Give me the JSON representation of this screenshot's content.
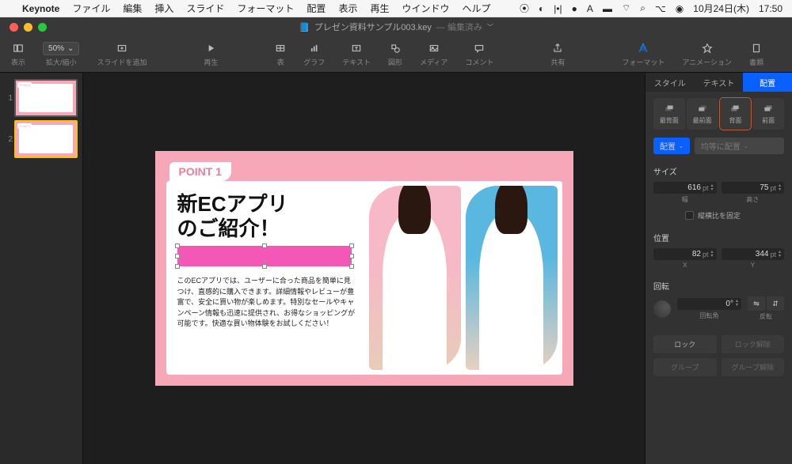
{
  "menubar": {
    "app": "Keynote",
    "items": [
      "ファイル",
      "編集",
      "挿入",
      "スライド",
      "フォーマット",
      "配置",
      "表示",
      "再生",
      "ウインドウ",
      "ヘルプ"
    ],
    "date": "10月24日(木)",
    "time": "17:50"
  },
  "titlebar": {
    "filename": "プレゼン資料サンプル003.key",
    "edited": "編集済み"
  },
  "toolbar": {
    "view": "表示",
    "zoom": "50%",
    "zoom_label": "拡大/縮小",
    "add_slide": "スライドを追加",
    "play": "再生",
    "table": "表",
    "chart": "グラフ",
    "text": "テキスト",
    "shape": "図形",
    "media": "メディア",
    "comment": "コメント",
    "share": "共有",
    "format": "フォーマット",
    "animate": "アニメーション",
    "document": "書類"
  },
  "slides": [
    {
      "num": "1",
      "selected": false
    },
    {
      "num": "2",
      "selected": true
    }
  ],
  "slide": {
    "tag": "POINT 1",
    "title_l1": "新ECアプリ",
    "title_l2": "のご紹介！",
    "body": "このECアプリでは、ユーザーに合った商品を簡単に見つけ、直感的に購入できます。詳細情報やレビューが豊富で、安全に買い物が楽しめます。特別なセールやキャンペーン情報も迅速に提供され、お得なショッピングが可能です。快適な買い物体験をお試しください！"
  },
  "inspector": {
    "tabs": {
      "style": "スタイル",
      "text": "テキスト",
      "arrange": "配置"
    },
    "layers": {
      "back_most": "最背面",
      "front_most": "最前面",
      "back": "背面",
      "front": "前面"
    },
    "align_label": "配置",
    "distribute": "均等に配置",
    "size_label": "サイズ",
    "width_val": "616",
    "height_val": "75",
    "unit": "pt",
    "width_sub": "幅",
    "height_sub": "高さ",
    "constrain": "縦横比を固定",
    "pos_label": "位置",
    "x_val": "82",
    "y_val": "344",
    "x_sub": "X",
    "y_sub": "Y",
    "rotate_label": "回転",
    "angle_val": "0°",
    "angle_sub": "回転角",
    "flip_sub": "反転",
    "lock": "ロック",
    "unlock": "ロック解除",
    "group": "グループ",
    "ungroup": "グループ解除"
  }
}
